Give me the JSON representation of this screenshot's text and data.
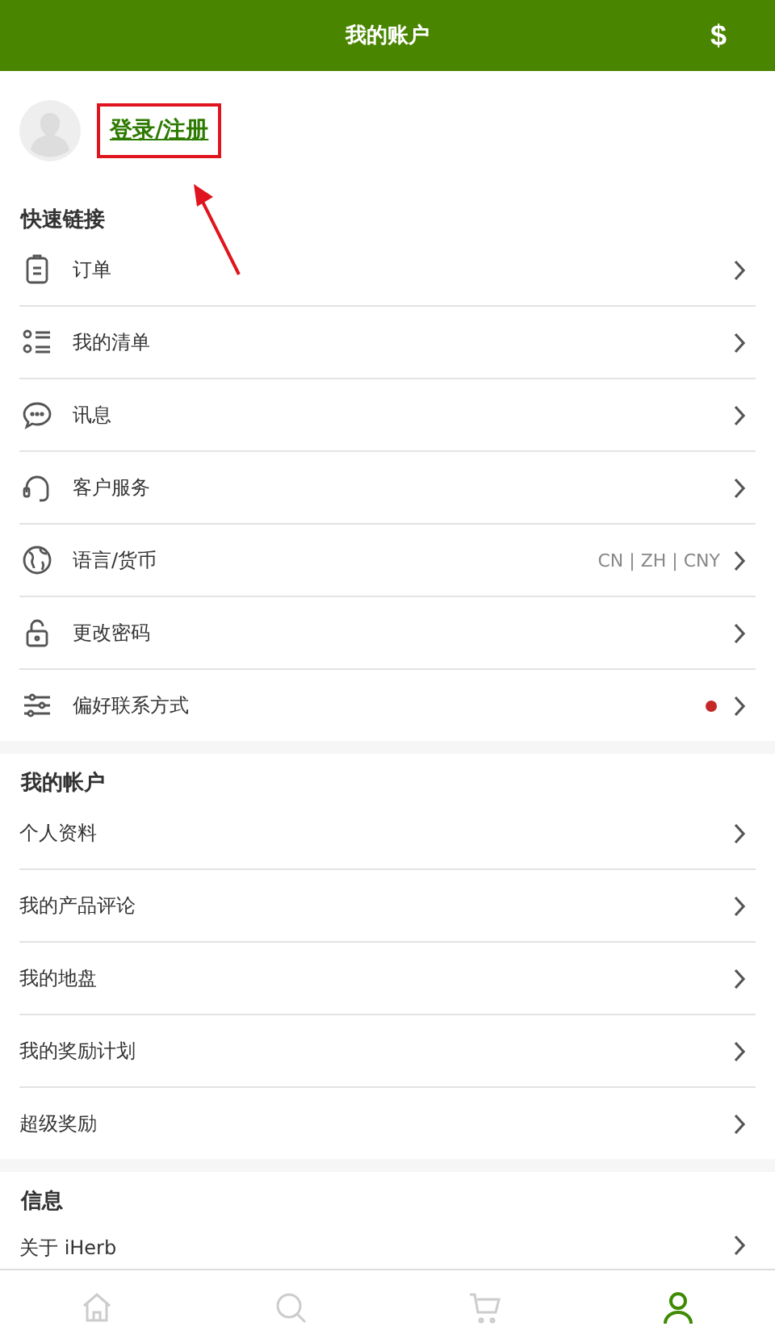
{
  "header": {
    "title": "我的账户",
    "action_icon": "$"
  },
  "profile": {
    "login_link": "登录/注册",
    "highlighted": true
  },
  "sections": [
    {
      "title": "快速链接",
      "items": [
        {
          "label": "订单",
          "kind": "clipboard"
        },
        {
          "label": "我的清单",
          "kind": "list"
        },
        {
          "label": "讯息",
          "kind": "chat"
        },
        {
          "label": "客户服务",
          "kind": "headset"
        },
        {
          "label": "语言/货币",
          "kind": "globe",
          "value": "CN | ZH | CNY"
        },
        {
          "label": "更改密码",
          "kind": "lock"
        },
        {
          "label": "偏好联系方式",
          "kind": "sliders",
          "alert": true
        }
      ]
    },
    {
      "title": "我的帐户",
      "items": [
        {
          "label": "个人资料"
        },
        {
          "label": "我的产品评论"
        },
        {
          "label": "我的地盘"
        },
        {
          "label": "我的奖励计划"
        },
        {
          "label": "超级奖励"
        }
      ]
    },
    {
      "title": "信息",
      "items": [
        {
          "label": "关于 iHerb"
        }
      ]
    }
  ],
  "tab_bar": [
    {
      "kind": "home",
      "selected": false
    },
    {
      "kind": "search",
      "selected": false
    },
    {
      "kind": "cart",
      "selected": false
    },
    {
      "kind": "account",
      "selected": true
    }
  ]
}
